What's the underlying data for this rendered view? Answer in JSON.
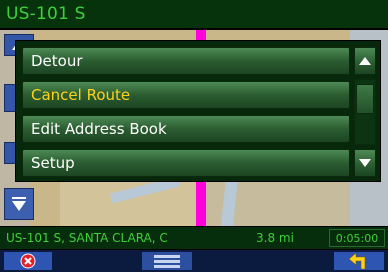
{
  "header": {
    "road_name": "US-101 S"
  },
  "menu": {
    "items": [
      {
        "label": "Detour",
        "active": false
      },
      {
        "label": "Cancel Route",
        "active": true
      },
      {
        "label": "Edit Address Book",
        "active": false
      },
      {
        "label": "Setup",
        "active": false
      }
    ]
  },
  "status": {
    "street": "US-101 S, SANTA CLARA, C",
    "distance": "3.8 mi",
    "time": "0:05:00"
  },
  "colors": {
    "header_bg": "#06320c",
    "header_text": "#3fcf3a",
    "menu_text": "#ffffff",
    "menu_active_text": "#ffd21a",
    "route_line": "#ff00dd"
  },
  "icons": {
    "close": "close-circle-icon",
    "menu": "menu-icon",
    "back": "back-arrow-icon",
    "scroll_up": "triangle-up-icon",
    "scroll_down": "triangle-down-icon"
  }
}
